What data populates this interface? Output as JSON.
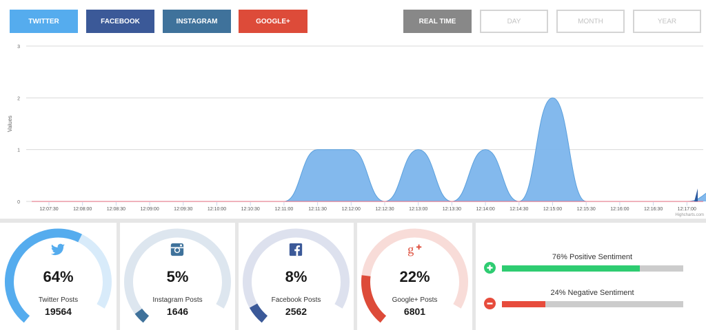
{
  "filters": {
    "networks": [
      {
        "label": "TWITTER",
        "color": "#55acee"
      },
      {
        "label": "FACEBOOK",
        "color": "#3b5998"
      },
      {
        "label": "INSTAGRAM",
        "color": "#3f729b"
      },
      {
        "label": "GOOGLE+",
        "color": "#dd4b39"
      }
    ],
    "periods": [
      {
        "label": "REAL TIME",
        "active": true
      },
      {
        "label": "DAY",
        "active": false
      },
      {
        "label": "MONTH",
        "active": false
      },
      {
        "label": "YEAR",
        "active": false
      }
    ]
  },
  "chart_data": {
    "type": "area",
    "ylabel": "Values",
    "ylim": [
      0,
      3
    ],
    "yticks": [
      0,
      1,
      2,
      3
    ],
    "xticks": [
      "12:07:30",
      "12:08:00",
      "12:08:30",
      "12:09:00",
      "12:09:30",
      "12:10:00",
      "12:10:30",
      "12:11:00",
      "12:11:30",
      "12:12:00",
      "12:12:30",
      "12:13:00",
      "12:13:30",
      "12:14:00",
      "12:14:30",
      "12:15:00",
      "12:15:30",
      "12:16:00",
      "12:16:30",
      "12:17:00"
    ],
    "x": [
      "12:07:30",
      "12:08:00",
      "12:08:30",
      "12:09:00",
      "12:09:30",
      "12:10:00",
      "12:10:30",
      "12:11:00",
      "12:11:30",
      "12:12:00",
      "12:12:30",
      "12:13:00",
      "12:13:30",
      "12:14:00",
      "12:14:30",
      "12:15:00",
      "12:15:30",
      "12:16:00",
      "12:16:30",
      "12:17:00",
      "12:17:10"
    ],
    "series": [
      {
        "values": [
          0,
          0,
          0,
          0,
          0,
          0,
          0,
          0,
          1,
          1,
          0,
          1,
          0,
          1,
          0,
          2,
          0,
          0,
          0,
          0,
          0.25
        ],
        "color": "#7cb5ec"
      }
    ],
    "credit": "Highcharts.com"
  },
  "stats": [
    {
      "network": "twitter",
      "icon": "twitter-icon",
      "percent_text": "64%",
      "fraction": 0.64,
      "label": "Twitter Posts",
      "count": "19564",
      "color": "#55acee",
      "track": "#d8ebfa"
    },
    {
      "network": "instagram",
      "icon": "instagram-icon",
      "percent_text": "5%",
      "fraction": 0.05,
      "label": "Instagram Posts",
      "count": "1646",
      "color": "#3f729b",
      "track": "#dde6ef"
    },
    {
      "network": "facebook",
      "icon": "facebook-icon",
      "percent_text": "8%",
      "fraction": 0.08,
      "label": "Facebook Posts",
      "count": "2562",
      "color": "#3b5998",
      "track": "#dde1ee"
    },
    {
      "network": "googleplus",
      "icon": "google-plus-icon",
      "percent_text": "22%",
      "fraction": 0.22,
      "label": "Google+ Posts",
      "count": "6801",
      "color": "#dd4b39",
      "track": "#f8dcd8"
    }
  ],
  "sentiment": {
    "positive": {
      "label": "76% Positive Sentiment",
      "fraction": 0.76,
      "color": "#2ecc71"
    },
    "negative": {
      "label": "24% Negative Sentiment",
      "fraction": 0.24,
      "color": "#e74c3c"
    }
  }
}
